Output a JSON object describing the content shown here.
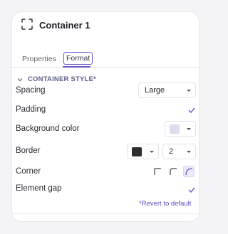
{
  "header": {
    "title": "Container 1",
    "icon": "frame-icon"
  },
  "tabs": [
    {
      "label": "Properties",
      "active": false
    },
    {
      "label": "Format",
      "active": true
    }
  ],
  "section": {
    "title": "CONTAINER STYLE*"
  },
  "rows": {
    "spacing": {
      "label": "Spacing",
      "value": "Large"
    },
    "padding": {
      "label": "Padding",
      "checked": true
    },
    "background": {
      "label": "Background color",
      "color": "#dcdcec"
    },
    "border": {
      "label": "Border",
      "color": "#2d2d2d",
      "width": "2"
    },
    "corner": {
      "label": "Corner",
      "options": [
        "square",
        "small-radius",
        "large-radius"
      ],
      "selected": "large-radius"
    },
    "element_gap": {
      "label": "Element gap",
      "checked": true
    }
  },
  "revert_label": "*Revert to default",
  "colors": {
    "accent": "#6b59d3",
    "panel_bg": "#ffffff",
    "page_bg": "#f4f4f6"
  }
}
